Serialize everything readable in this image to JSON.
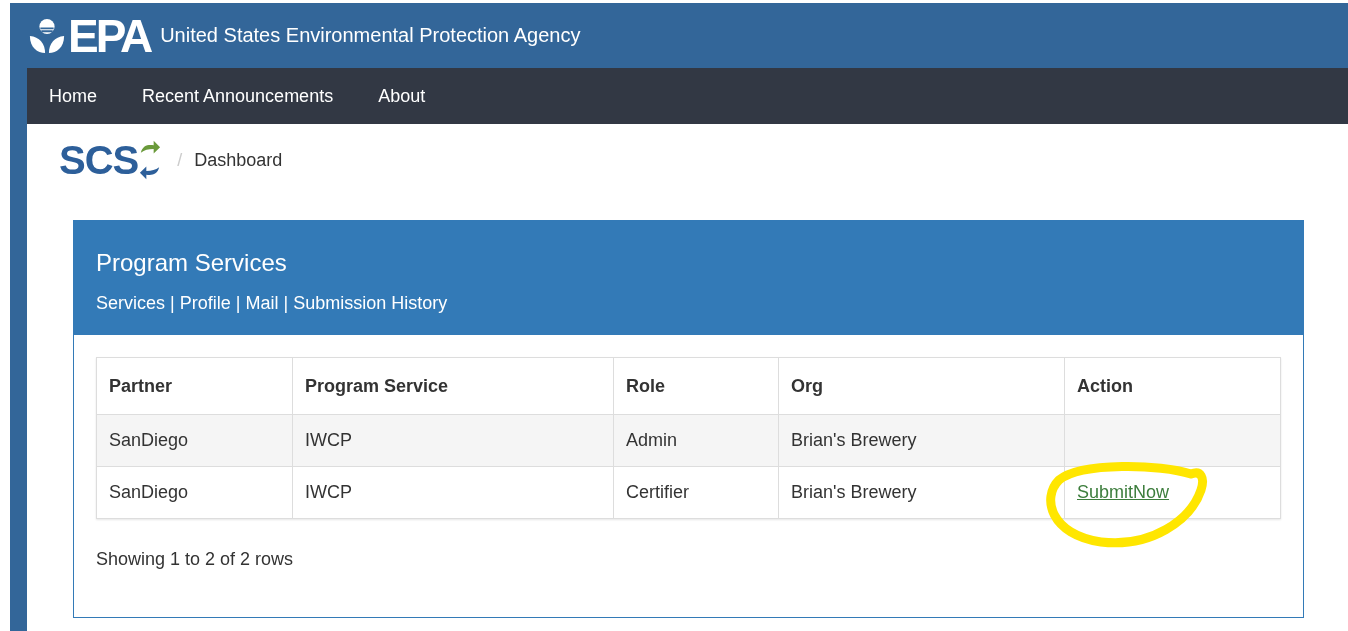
{
  "agency": {
    "logo": "EPA",
    "name": "United States Environmental Protection Agency"
  },
  "nav": [
    {
      "label": "Home"
    },
    {
      "label": "Recent Announcements"
    },
    {
      "label": "About"
    }
  ],
  "breadcrumb": {
    "logo": "SCS",
    "separator": "/",
    "current": "Dashboard"
  },
  "panel": {
    "title": "Program Services",
    "separator": "|",
    "links": [
      "Services",
      "Profile",
      "Mail",
      "Submission History"
    ]
  },
  "table": {
    "columns": [
      "Partner",
      "Program Service",
      "Role",
      "Org",
      "Action"
    ],
    "rows": [
      {
        "partner": "SanDiego",
        "program_service": "IWCP",
        "role": "Admin",
        "org": "Brian's Brewery"
      },
      {
        "partner": "SanDiego",
        "program_service": "IWCP",
        "role": "Certifier",
        "org": "Brian's Brewery",
        "action": {
          "label": "SubmitNow",
          "highlighted": true
        }
      }
    ]
  },
  "footer": "Showing 1 to 2 of 2 rows"
}
